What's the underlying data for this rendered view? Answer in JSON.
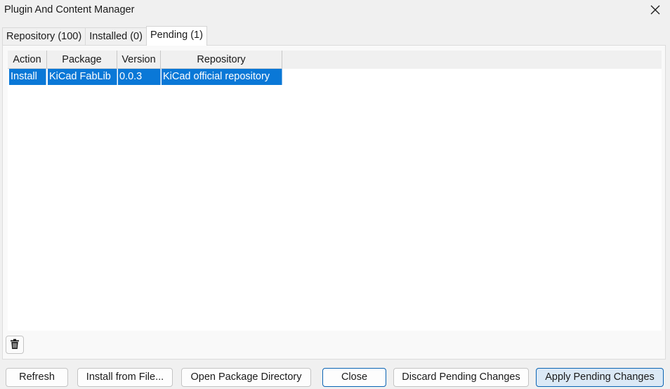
{
  "window": {
    "title": "Plugin And Content Manager",
    "close_icon": "close-icon"
  },
  "tabs": [
    {
      "label": "Repository (100)",
      "active": false
    },
    {
      "label": "Installed (0)",
      "active": false
    },
    {
      "label": "Pending (1)",
      "active": true
    }
  ],
  "pending_table": {
    "columns": [
      "Action",
      "Package",
      "Version",
      "Repository"
    ],
    "rows": [
      {
        "action": "Install",
        "package": "KiCad FabLib",
        "version": "0.0.3",
        "repository": "KiCad official repository",
        "selected": true
      }
    ]
  },
  "toolbar": {
    "delete_icon": "trash-icon"
  },
  "buttons": {
    "refresh": "Refresh",
    "install_from_file": "Install from File...",
    "open_package_directory": "Open Package Directory",
    "close": "Close",
    "discard_pending": "Discard Pending Changes",
    "apply_pending": "Apply Pending Changes"
  },
  "colors": {
    "selection": "#0a78d7",
    "accent_border": "#0a64b4"
  }
}
